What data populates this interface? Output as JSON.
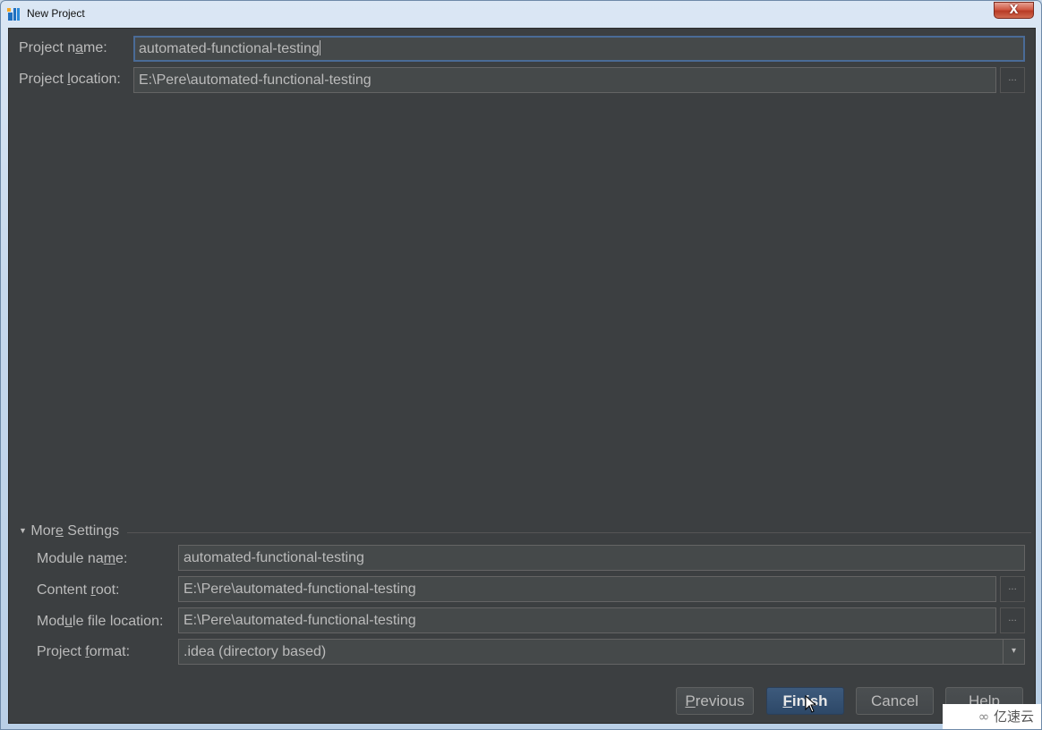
{
  "window": {
    "title": "New Project",
    "close_label": "X"
  },
  "form": {
    "project_name": {
      "label_pre": "Project n",
      "label_mn": "a",
      "label_post": "me:",
      "value": "automated-functional-testing"
    },
    "project_location": {
      "label_pre": "Project ",
      "label_mn": "l",
      "label_post": "ocation:",
      "value": "E:\\Pere\\automated-functional-testing",
      "browse_label": "..."
    }
  },
  "more_settings": {
    "header_pre": "Mor",
    "header_mn": "e",
    "header_post": " Settings",
    "expanded_icon": "triangle-down-icon",
    "module_name": {
      "label_pre": "Module na",
      "label_mn": "m",
      "label_post": "e:",
      "value": "automated-functional-testing"
    },
    "content_root": {
      "label_pre": "Content ",
      "label_mn": "r",
      "label_post": "oot:",
      "value": "E:\\Pere\\automated-functional-testing",
      "browse_label": "..."
    },
    "module_file_location": {
      "label_pre": "Mod",
      "label_mn": "u",
      "label_post": "le file location:",
      "value": "E:\\Pere\\automated-functional-testing",
      "browse_label": "..."
    },
    "project_format": {
      "label_pre": "Project ",
      "label_mn": "f",
      "label_post": "ormat:",
      "value": ".idea (directory based)",
      "arrow": "▾"
    }
  },
  "buttons": {
    "previous": {
      "mn": "P",
      "rest": "revious"
    },
    "finish": {
      "mn": "F",
      "rest": "inish"
    },
    "cancel": "Cancel",
    "help": "Help"
  },
  "watermark": "亿速云",
  "colors": {
    "panel_bg": "#3c3f41",
    "field_bg": "#45494a",
    "focus_border": "#4a6b97",
    "default_button": "#365880",
    "text": "#bbbbbb"
  }
}
